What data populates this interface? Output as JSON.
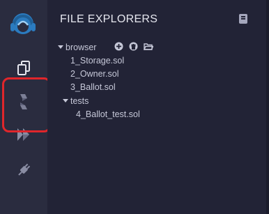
{
  "sidebar": {
    "icons": [
      {
        "name": "logo-icon"
      },
      {
        "name": "file-explorers-icon"
      },
      {
        "name": "solidity-compiler-icon"
      },
      {
        "name": "deploy-run-icon"
      },
      {
        "name": "plugin-manager-icon"
      }
    ]
  },
  "panel": {
    "title": "FILE EXPLORERS"
  },
  "tree": {
    "workspace": "browser",
    "files": [
      "1_Storage.sol",
      "2_Owner.sol",
      "3_Ballot.sol"
    ],
    "folder": "tests",
    "folder_files": [
      "4_Ballot_test.sol"
    ]
  },
  "colors": {
    "accent": "#2b7bbf",
    "annotation": "#e0262b"
  }
}
